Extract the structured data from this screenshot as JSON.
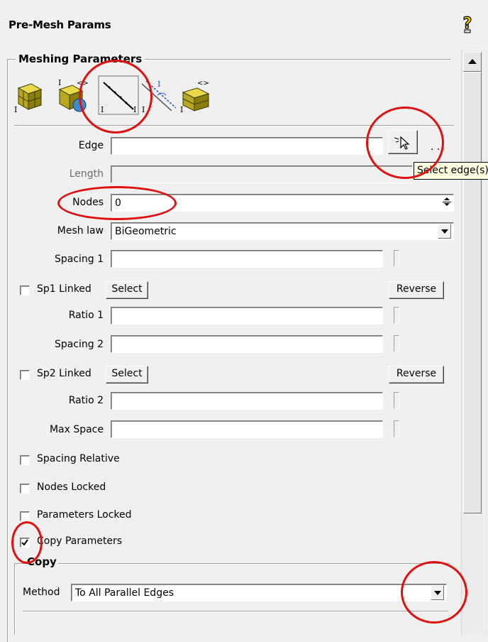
{
  "window": {
    "title": "Pre-Mesh Params",
    "help_icon": "question-mark-icon"
  },
  "group": {
    "legend": "Meshing Parameters"
  },
  "toolbar": {
    "icons": [
      "blocks-icon",
      "blocks-globe-icon",
      "edge-mesh-icon",
      "parallel-edge-mesh-icon",
      "block-dims-icon"
    ]
  },
  "edge": {
    "label": "Edge",
    "value": "",
    "select_icon": "select-cursor-icon",
    "more": ". ."
  },
  "tooltip": {
    "text": "Select edge(s)"
  },
  "length": {
    "label": "Length",
    "value": ""
  },
  "nodes": {
    "label": "Nodes",
    "value": "0"
  },
  "mesh_law": {
    "label": "Mesh law",
    "value": "BiGeometric"
  },
  "spacing1": {
    "label": "Spacing 1",
    "value": ""
  },
  "sp1": {
    "label": "Sp1 Linked",
    "checked": false,
    "select_label": "Select",
    "reverse_label": "Reverse"
  },
  "ratio1": {
    "label": "Ratio 1",
    "value": ""
  },
  "spacing2": {
    "label": "Spacing 2",
    "value": ""
  },
  "sp2": {
    "label": "Sp2 Linked",
    "checked": false,
    "select_label": "Select",
    "reverse_label": "Reverse"
  },
  "ratio2": {
    "label": "Ratio 2",
    "value": ""
  },
  "max_space": {
    "label": "Max Space",
    "value": ""
  },
  "options": {
    "spacing_relative": {
      "label": "Spacing Relative",
      "checked": false
    },
    "nodes_locked": {
      "label": "Nodes Locked",
      "checked": false
    },
    "parameters_locked": {
      "label": "Parameters Locked",
      "checked": false
    },
    "copy_parameters": {
      "label": "Copy Parameters",
      "checked": true
    }
  },
  "copy": {
    "legend": "Copy",
    "method_label": "Method",
    "method_value": "To All Parallel Edges"
  },
  "annotation_color": "#e01010"
}
